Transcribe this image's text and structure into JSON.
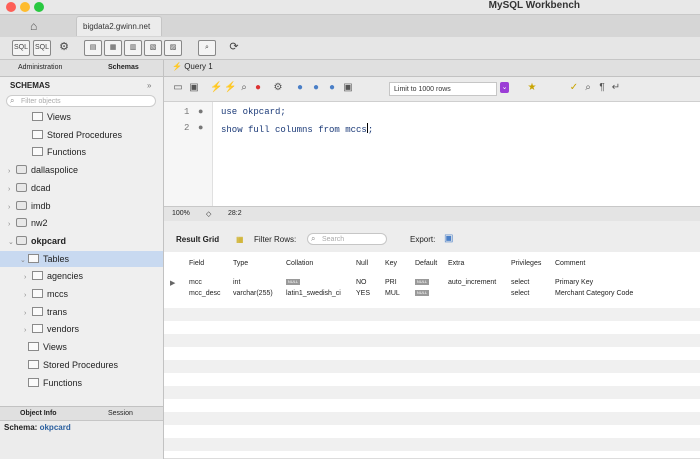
{
  "window": {
    "app_title": "MySQL Workbench",
    "connection_tab": "bigdata2.gwinn.net"
  },
  "colors": {
    "close": "#fe5f57",
    "minimize": "#febc2e",
    "maximize": "#28c840",
    "selection": "#c8d9f0",
    "limit_arrow": "#9b3dd6"
  },
  "left_panel": {
    "tabs": [
      "Administration",
      "Schemas"
    ],
    "schemas_title": "SCHEMAS",
    "filter_placeholder": "Filter objects",
    "tree": [
      {
        "label": "Views",
        "indent": 2,
        "icon": "folder-icon",
        "expander": ""
      },
      {
        "label": "Stored Procedures",
        "indent": 2,
        "icon": "folder-icon",
        "expander": ""
      },
      {
        "label": "Functions",
        "indent": 2,
        "icon": "folder-icon",
        "expander": ""
      },
      {
        "label": "dallaspolice",
        "indent": 0,
        "icon": "database-icon",
        "expander": "›"
      },
      {
        "label": "dcad",
        "indent": 0,
        "icon": "database-icon",
        "expander": "›"
      },
      {
        "label": "imdb",
        "indent": 0,
        "icon": "database-icon",
        "expander": "›"
      },
      {
        "label": "nw2",
        "indent": 0,
        "icon": "database-icon",
        "expander": "›"
      },
      {
        "label": "okpcard",
        "indent": 0,
        "icon": "database-icon",
        "expander": "⌄",
        "bold": true
      },
      {
        "label": "Tables",
        "indent": 1,
        "icon": "folder-icon",
        "expander": "⌄",
        "selected": true
      },
      {
        "label": "agencies",
        "indent": 2,
        "icon": "table-icon",
        "expander": "›"
      },
      {
        "label": "mccs",
        "indent": 2,
        "icon": "table-icon",
        "expander": "›"
      },
      {
        "label": "trans",
        "indent": 2,
        "icon": "table-icon",
        "expander": "›"
      },
      {
        "label": "vendors",
        "indent": 2,
        "icon": "table-icon",
        "expander": "›"
      },
      {
        "label": "Views",
        "indent": 1,
        "icon": "folder-icon",
        "expander": ""
      },
      {
        "label": "Stored Procedures",
        "indent": 1,
        "icon": "folder-icon",
        "expander": ""
      },
      {
        "label": "Functions",
        "indent": 1,
        "icon": "folder-icon",
        "expander": ""
      }
    ]
  },
  "object_info": {
    "tabs": [
      "Object Info",
      "Session"
    ],
    "schema_label": "Schema:",
    "schema_value": "okpcard"
  },
  "query": {
    "tab_label": "Query 1",
    "limit_label": "Limit to 1000 rows",
    "lines": [
      {
        "num": "1",
        "text": "use okpcard;"
      },
      {
        "num": "2",
        "text": "show full columns from mccs"
      }
    ]
  },
  "status": {
    "zoom": "100%",
    "position": "28:2"
  },
  "result": {
    "grid_label": "Result Grid",
    "filter_label": "Filter Rows:",
    "search_placeholder": "Search",
    "export_label": "Export:",
    "columns": [
      "Field",
      "Type",
      "Collation",
      "Null",
      "Key",
      "Default",
      "Extra",
      "Privileges",
      "Comment"
    ],
    "rows": [
      {
        "field": "mcc",
        "type": "int",
        "collation": "NULL",
        "null": "NO",
        "key": "PRI",
        "default": "NULL",
        "extra": "auto_increment",
        "privileges": "select",
        "comment": "Primary Key"
      },
      {
        "field": "mcc_desc",
        "type": "varchar(255)",
        "collation": "latin1_swedish_ci",
        "null": "YES",
        "key": "MUL",
        "default": "NULL",
        "extra": "",
        "privileges": "select",
        "comment": "Merchant Category Code"
      }
    ]
  }
}
